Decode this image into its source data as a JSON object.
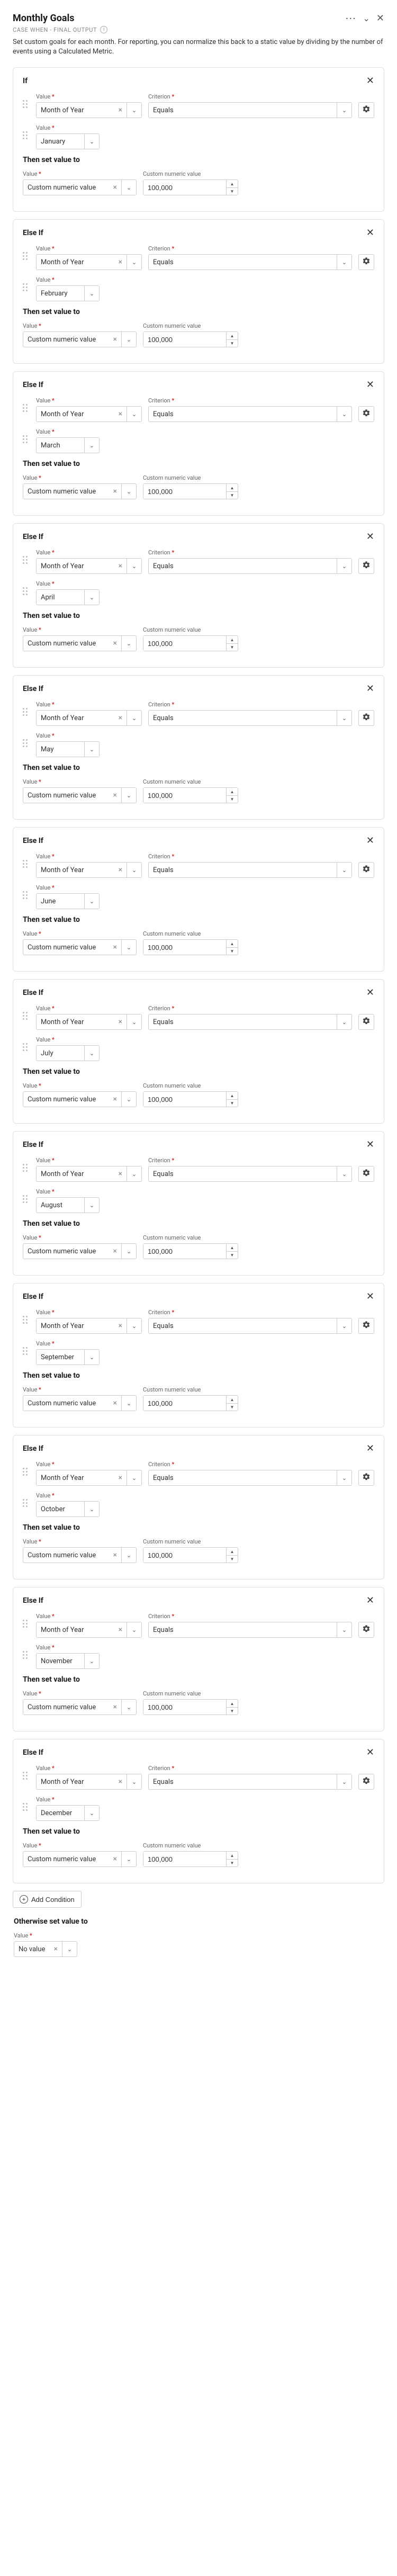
{
  "header": {
    "title": "Monthly Goals",
    "subtitle": "CASE WHEN - FINAL OUTPUT",
    "description": "Set custom goals for each month. For reporting, you can normalize this back to a static value by dividing by the number of events using a Calculated Metric."
  },
  "labels": {
    "value": "Value",
    "criterion": "Criterion",
    "custom_numeric_value": "Custom numeric value",
    "then_set_value_to": "Then set value to",
    "if": "If",
    "else_if": "Else If",
    "add_condition": "Add Condition",
    "otherwise_set_value_to": "Otherwise set value to"
  },
  "field_values": {
    "month_of_year": "Month of Year",
    "equals": "Equals",
    "custom_numeric_value": "Custom numeric value",
    "no_value": "No value"
  },
  "conditions": [
    {
      "type": "if",
      "month": "January",
      "target": "100,000"
    },
    {
      "type": "else_if",
      "month": "February",
      "target": "100,000"
    },
    {
      "type": "else_if",
      "month": "March",
      "target": "100,000"
    },
    {
      "type": "else_if",
      "month": "April",
      "target": "100,000"
    },
    {
      "type": "else_if",
      "month": "May",
      "target": "100,000"
    },
    {
      "type": "else_if",
      "month": "June",
      "target": "100,000"
    },
    {
      "type": "else_if",
      "month": "July",
      "target": "100,000"
    },
    {
      "type": "else_if",
      "month": "August",
      "target": "100,000"
    },
    {
      "type": "else_if",
      "month": "September",
      "target": "100,000"
    },
    {
      "type": "else_if",
      "month": "October",
      "target": "100,000"
    },
    {
      "type": "else_if",
      "month": "November",
      "target": "100,000"
    },
    {
      "type": "else_if",
      "month": "December",
      "target": "100,000"
    }
  ]
}
